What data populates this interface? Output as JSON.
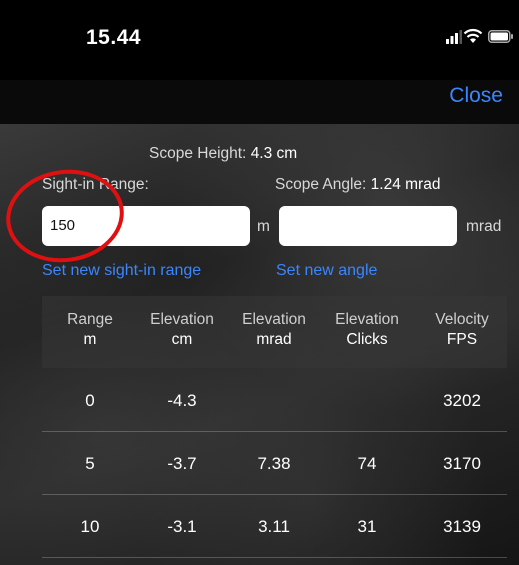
{
  "status": {
    "time": "15.44",
    "icons": [
      "cellular-signal-icon",
      "wifi-icon",
      "battery-icon"
    ]
  },
  "nav": {
    "close_label": "Close"
  },
  "scope": {
    "height_label": "Scope Height:",
    "height_value": "4.3 cm",
    "sightin_label": "Sight-in Range:",
    "angle_label": "Scope Angle:",
    "angle_value": "1.24 mrad"
  },
  "inputs": {
    "range_value": "150",
    "range_unit": "m",
    "angle_value": "",
    "angle_unit": "mrad"
  },
  "links": {
    "set_range": "Set new sight-in range",
    "set_angle": "Set new angle"
  },
  "table": {
    "headers": [
      {
        "l1": "Range",
        "l2": "m"
      },
      {
        "l1": "Elevation",
        "l2": "cm"
      },
      {
        "l1": "Elevation",
        "l2": "mrad"
      },
      {
        "l1": "Elevation",
        "l2": "Clicks"
      },
      {
        "l1": "Velocity",
        "l2": "FPS"
      }
    ],
    "rows": [
      [
        "0",
        "-4.3",
        "",
        "",
        "3202"
      ],
      [
        "5",
        "-3.7",
        "7.38",
        "74",
        "3170"
      ],
      [
        "10",
        "-3.1",
        "3.11",
        "31",
        "3139"
      ]
    ]
  },
  "colors": {
    "accent": "#3a86ff",
    "annotation": "#e01010"
  }
}
